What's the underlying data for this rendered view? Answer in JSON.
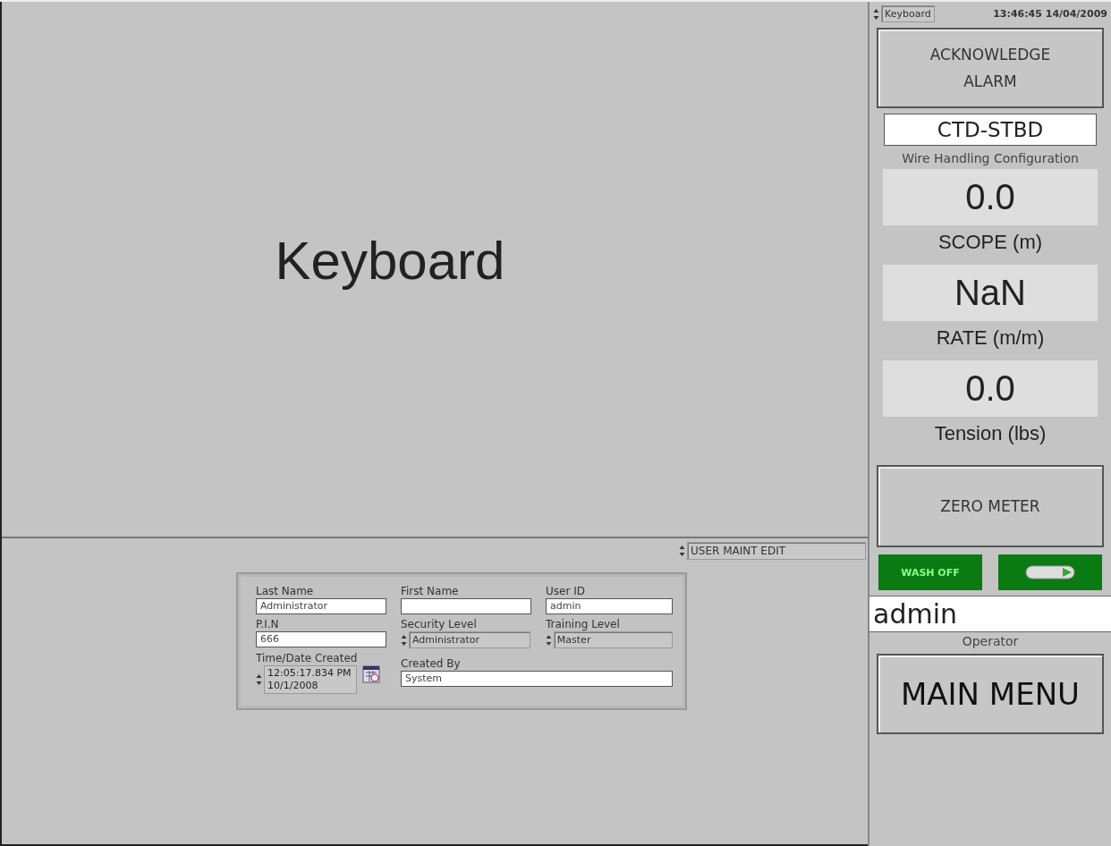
{
  "main_panel": {
    "title": "Keyboard"
  },
  "page_selector": {
    "value": "USER MAINT EDIT"
  },
  "user_form": {
    "last_name": {
      "label": "Last Name",
      "value": "Administrator"
    },
    "first_name": {
      "label": "First Name"
    },
    "user_id": {
      "label": "User ID",
      "value": "admin"
    },
    "pin": {
      "label": "P.I.N",
      "value": "666"
    },
    "security_level": {
      "label": "Security Level",
      "value": "Administrator"
    },
    "training_level": {
      "label": "Training Level",
      "value": "Master"
    },
    "created": {
      "label": "Time/Date Created",
      "time": "12:05:17.834 PM",
      "date": "10/1/2008"
    },
    "created_by": {
      "label": "Created By",
      "value": "System"
    }
  },
  "sidebar": {
    "mode_selector": {
      "value": "Keyboard"
    },
    "clock": "13:46:45 14/04/2009",
    "acknowledge_button": {
      "label": "ACKNOWLEDGE ALARM"
    },
    "configuration": {
      "value": "CTD-STBD",
      "label": "Wire Handling Configuration"
    },
    "readings": [
      {
        "value": "0.0",
        "label": "SCOPE (m)"
      },
      {
        "value": "NaN",
        "label": "RATE (m/m)"
      },
      {
        "value": "0.0",
        "label": "Tension (lbs)"
      }
    ],
    "zero_button": {
      "label": "ZERO METER"
    },
    "wash": {
      "label": "WASH OFF",
      "on": false
    },
    "operator": {
      "value": "admin",
      "label": "Operator"
    },
    "main_menu_button": {
      "label": "MAIN MENU"
    }
  }
}
